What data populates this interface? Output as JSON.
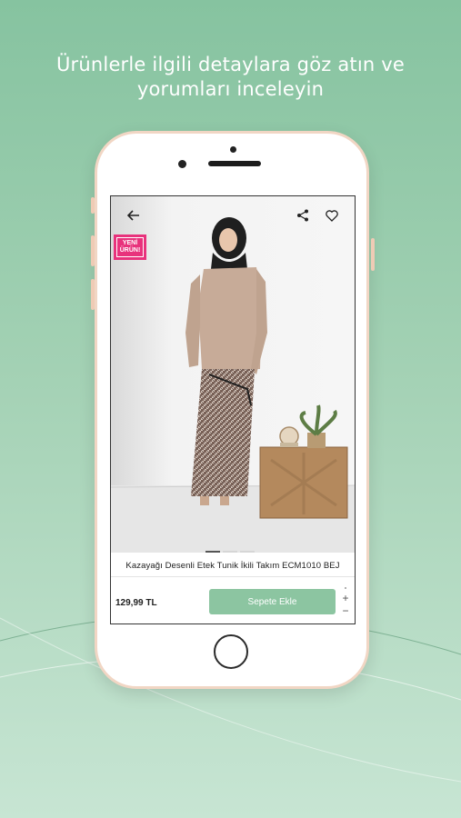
{
  "headline": {
    "line1": "Ürünlerle ilgili detaylara göz atın ve",
    "line2": "yorumları inceleyin"
  },
  "app": {
    "badge": {
      "line1": "YENİ",
      "line2": "ÜRÜN!"
    },
    "icons": {
      "back": "arrow-left-icon",
      "share": "share-icon",
      "favorite": "heart-icon"
    },
    "gallery": {
      "active_index": 0,
      "count": 3
    },
    "product_title": "Kazayağı Desenli Etek Tunik İkili Takım ECM1010 BEJ",
    "price": "129,99 TL",
    "add_to_cart_label": "Sepete Ekle",
    "stepper": {
      "plus": "+",
      "minus": "−"
    }
  },
  "colors": {
    "background_top": "#86c3a0",
    "background_bottom": "#c7e5d3",
    "cart_button": "#8cc5a1",
    "badge": "#e8327c",
    "phone_frame": "#f1d6c4"
  }
}
